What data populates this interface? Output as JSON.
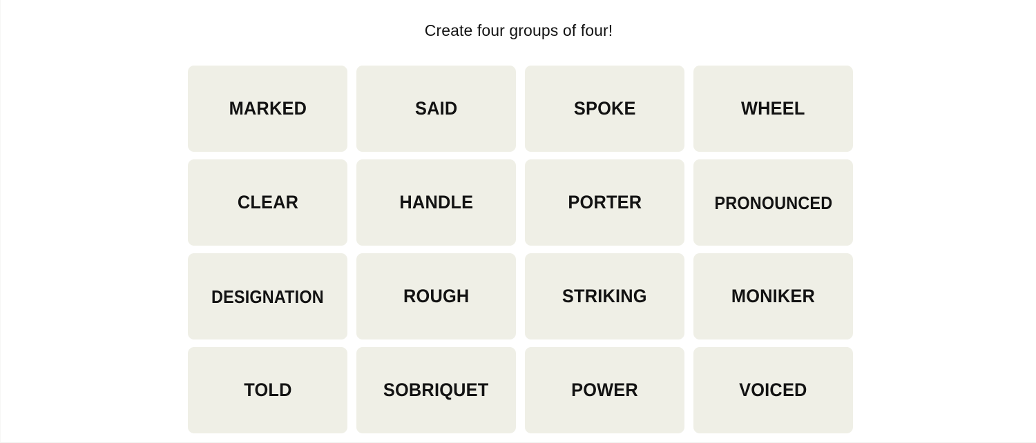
{
  "page": {
    "title": "Create four groups of four!",
    "background_color": "#ffffff",
    "tile_color": "#efefe6",
    "text_color": "#121212"
  },
  "board": {
    "rows": 4,
    "columns": 4,
    "tiles": [
      {
        "label": "MARKED"
      },
      {
        "label": "SAID"
      },
      {
        "label": "SPOKE"
      },
      {
        "label": "WHEEL"
      },
      {
        "label": "CLEAR"
      },
      {
        "label": "HANDLE"
      },
      {
        "label": "PORTER"
      },
      {
        "label": "PRONOUNCED"
      },
      {
        "label": "DESIGNATION"
      },
      {
        "label": "ROUGH"
      },
      {
        "label": "STRIKING"
      },
      {
        "label": "MONIKER"
      },
      {
        "label": "TOLD"
      },
      {
        "label": "SOBRIQUET"
      },
      {
        "label": "POWER"
      },
      {
        "label": "VOICED"
      }
    ]
  }
}
